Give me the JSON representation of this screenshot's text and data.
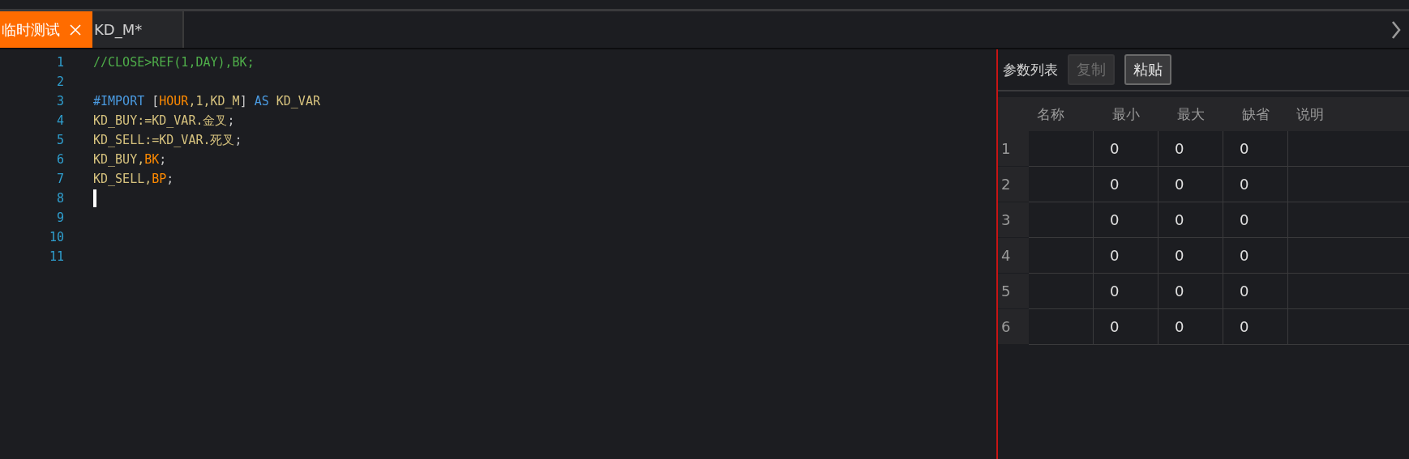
{
  "tabs": [
    {
      "label": "临时测试",
      "selected": true,
      "closable": true
    },
    {
      "label": "KD_M*",
      "selected": false,
      "closable": false
    }
  ],
  "editor": {
    "lines": [
      {
        "number": "1",
        "kind": "code",
        "tokens": [
          {
            "text": "//CLOSE>REF(1,DAY),BK;",
            "kind": "comment"
          }
        ]
      },
      {
        "number": "2",
        "kind": "code"
      },
      {
        "number": "3",
        "kind": "code",
        "tokens": [
          {
            "text": "#IMPORT",
            "kind": "keyword"
          },
          {
            "text": " [",
            "kind": "plain"
          },
          {
            "text": "HOUR",
            "kind": "constant"
          },
          {
            "text": ",1,KD_M",
            "kind": "ident"
          },
          {
            "text": "] ",
            "kind": "plain"
          },
          {
            "text": "AS",
            "kind": "keyword"
          },
          {
            "text": " KD_VAR",
            "kind": "ident"
          }
        ]
      },
      {
        "number": "4",
        "kind": "code",
        "tokens": [
          {
            "text": "KD_BUY:=KD_VAR.金叉",
            "kind": "ident"
          },
          {
            "text": ";",
            "kind": "plain"
          }
        ]
      },
      {
        "number": "5",
        "kind": "code",
        "tokens": [
          {
            "text": "KD_SELL:=KD_VAR.死叉",
            "kind": "ident"
          },
          {
            "text": ";",
            "kind": "plain"
          }
        ]
      },
      {
        "number": "6",
        "kind": "code",
        "tokens": [
          {
            "text": "KD_BUY,",
            "kind": "ident"
          },
          {
            "text": "BK",
            "kind": "constant"
          },
          {
            "text": ";",
            "kind": "plain"
          }
        ]
      },
      {
        "number": "7",
        "kind": "code",
        "tokens": [
          {
            "text": "KD_SELL,",
            "kind": "ident"
          },
          {
            "text": "BP",
            "kind": "constant"
          },
          {
            "text": ";",
            "kind": "plain"
          }
        ]
      },
      {
        "number": "8",
        "kind": "cursor"
      },
      {
        "number": "9",
        "kind": "code"
      },
      {
        "number": "10",
        "kind": "code"
      },
      {
        "number": "11",
        "kind": "code"
      }
    ]
  },
  "params": {
    "title": "参数列表",
    "buttons": [
      {
        "label": "复制",
        "disabled": true
      },
      {
        "label": "粘贴",
        "disabled": false
      }
    ],
    "columns": [
      "名称",
      "最小",
      "最大",
      "缺省",
      "说明"
    ],
    "rows": [
      {
        "index": "1",
        "min": "0",
        "max": "0",
        "default": "0"
      },
      {
        "index": "2",
        "min": "0",
        "max": "0",
        "default": "0"
      },
      {
        "index": "3",
        "min": "0",
        "max": "0",
        "default": "0"
      },
      {
        "index": "4",
        "min": "0",
        "max": "0",
        "default": "0"
      },
      {
        "index": "5",
        "min": "0",
        "max": "0",
        "default": "0"
      },
      {
        "index": "6",
        "min": "0",
        "max": "0",
        "default": "0"
      }
    ]
  }
}
